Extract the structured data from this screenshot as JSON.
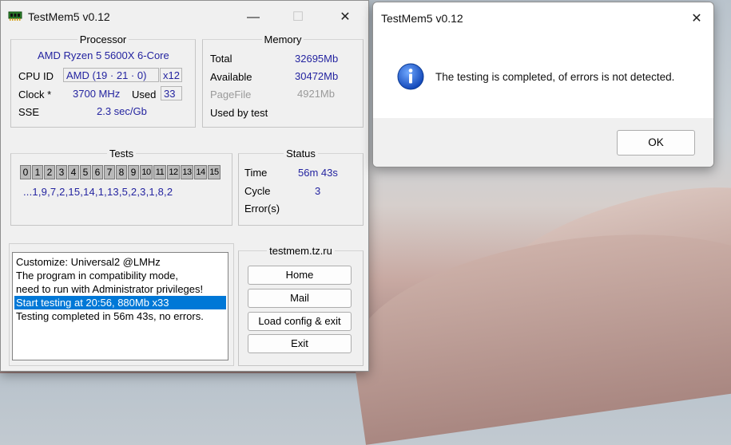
{
  "main_window": {
    "title": "TestMem5 v0.12",
    "controls": {
      "minimize": "—",
      "maximize": "☐",
      "close": "✕"
    },
    "processor": {
      "legend": "Processor",
      "name": "AMD Ryzen 5 5600X 6-Core",
      "cpu_id_label": "CPU ID",
      "cpu_id_value": "AMD  (19 · 21 · 0)",
      "threads": "x12",
      "clock_label": "Clock *",
      "clock_value": "3700 MHz",
      "used_label": "Used",
      "used_value": "33",
      "sse_label": "SSE",
      "sse_value": "2.3 sec/Gb"
    },
    "memory": {
      "legend": "Memory",
      "total_label": "Total",
      "total_value": "32695Mb",
      "available_label": "Available",
      "available_value": "30472Mb",
      "pagefile_label": "PageFile",
      "pagefile_value": "4921Mb",
      "used_by_test_label": "Used by test"
    },
    "tests": {
      "legend": "Tests",
      "cells": [
        "0",
        "1",
        "2",
        "3",
        "4",
        "5",
        "6",
        "7",
        "8",
        "9",
        "10",
        "11",
        "12",
        "13",
        "14",
        "15"
      ],
      "sequence": "...1,9,7,2,15,14,1,13,5,2,3,1,8,2"
    },
    "status": {
      "legend": "Status",
      "time_label": "Time",
      "time_value": "56m 43s",
      "cycle_label": "Cycle",
      "cycle_value": "3",
      "errors_label": "Error(s)"
    },
    "log": [
      "Customize: Universal2 @LMHz",
      "The program in compatibility mode,",
      "need to run with Administrator privileges!",
      "Start testing at 20:56, 880Mb x33",
      "Testing completed in 56m 43s, no errors."
    ],
    "links": {
      "legend": "testmem.tz.ru",
      "home": "Home",
      "mail": "Mail",
      "load_config": "Load config & exit",
      "exit": "Exit"
    }
  },
  "message_box": {
    "title": "TestMem5 v0.12",
    "close": "✕",
    "text": "The testing is completed, of errors is not detected.",
    "ok": "OK",
    "icon": "info-icon"
  }
}
